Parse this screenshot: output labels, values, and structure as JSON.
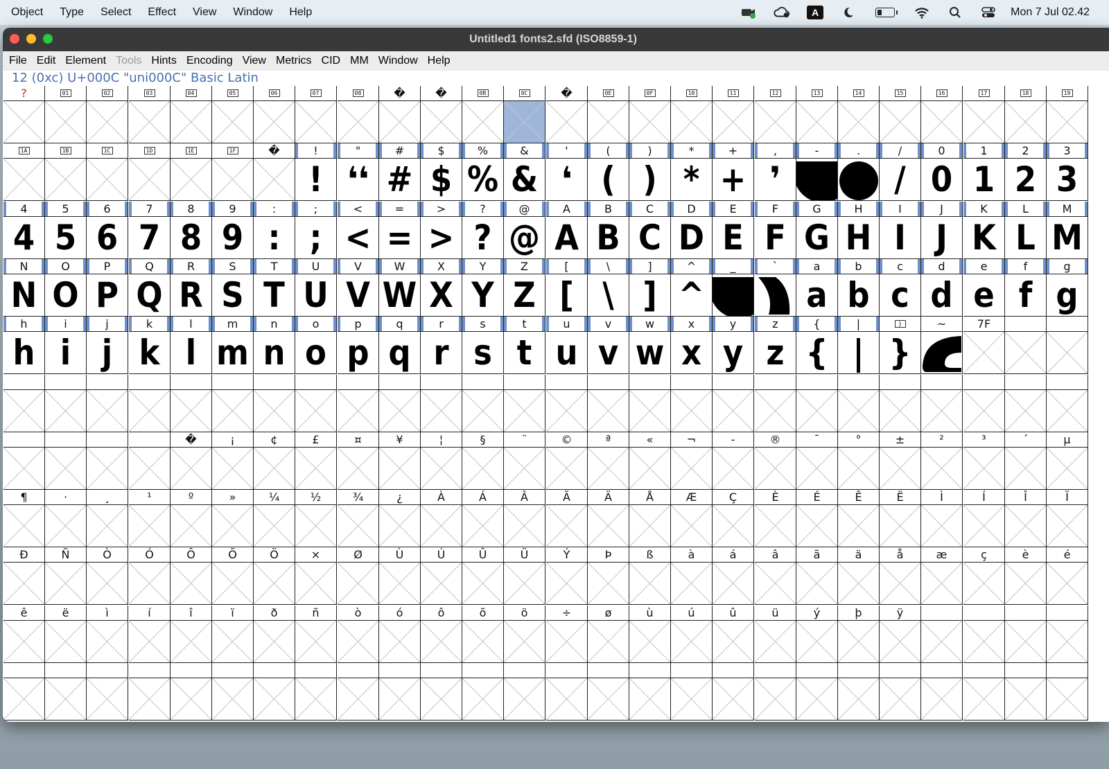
{
  "system_menubar": {
    "items": [
      "Object",
      "Type",
      "Select",
      "Effect",
      "View",
      "Window",
      "Help"
    ],
    "status_icons": [
      "camera-icon",
      "creative-cloud-icon",
      "input-source-icon",
      "moon-icon",
      "battery-icon",
      "wifi-icon",
      "search-icon",
      "control-center-icon"
    ],
    "input_source_letter": "A",
    "clock": "Mon 7 Jul  02.42"
  },
  "window": {
    "title": "Untitled1  fonts2.sfd (ISO8859-1)",
    "menu": [
      {
        "label": "File",
        "enabled": true
      },
      {
        "label": "Edit",
        "enabled": true
      },
      {
        "label": "Element",
        "enabled": true
      },
      {
        "label": "Tools",
        "enabled": false
      },
      {
        "label": "Hints",
        "enabled": true
      },
      {
        "label": "Encoding",
        "enabled": true
      },
      {
        "label": "View",
        "enabled": true
      },
      {
        "label": "Metrics",
        "enabled": true
      },
      {
        "label": "CID",
        "enabled": true
      },
      {
        "label": "MM",
        "enabled": true
      },
      {
        "label": "Window",
        "enabled": true
      },
      {
        "label": "Help",
        "enabled": true
      }
    ],
    "info_line": "12 (0xc) U+000C \"uni000C\" Basic Latin"
  },
  "grid": {
    "columns_visible": 26,
    "selected_index": 12,
    "accent_color": "#6f90c7",
    "selection_color": "#9fb6db",
    "labels": [
      "?",
      "01",
      "02",
      "03",
      "04",
      "05",
      "06",
      "07",
      "08",
      "�",
      "�",
      "0B",
      "0C",
      "�",
      "0E",
      "0F",
      "10",
      "11",
      "12",
      "13",
      "14",
      "15",
      "16",
      "17",
      "18",
      "19",
      "1A",
      "1B",
      "1C",
      "1D",
      "1E",
      "1F",
      "�",
      "!",
      "\"",
      "#",
      "$",
      "%",
      "&",
      "'",
      "(",
      ")",
      "*",
      "+",
      ",",
      "-",
      ".",
      "/",
      "0",
      "1",
      "2",
      "3",
      "4",
      "5",
      "6",
      "7",
      "8",
      "9",
      ":",
      ";",
      "<",
      "=",
      ">",
      "?",
      "@",
      "A",
      "B",
      "C",
      "D",
      "E",
      "F",
      "G",
      "H",
      "I",
      "J",
      "K",
      "L",
      "M",
      "N",
      "O",
      "P",
      "Q",
      "R",
      "S",
      "T",
      "U",
      "V",
      "W",
      "X",
      "Y",
      "Z",
      "[",
      "\\",
      "]",
      "^",
      "_",
      "`",
      "a",
      "b",
      "c",
      "d",
      "e",
      "f",
      "g",
      "h",
      "i",
      "j",
      "k",
      "l",
      "m",
      "n",
      "o",
      "p",
      "q",
      "r",
      "s",
      "t",
      "u",
      "v",
      "w",
      "x",
      "y",
      "z",
      "{",
      "|",
      "}",
      "~",
      "7F",
      "",
      "",
      "",
      "",
      "",
      "",
      "",
      "",
      "",
      "",
      "",
      "",
      "",
      "",
      "",
      "",
      "",
      "",
      "",
      "",
      "",
      "",
      "",
      "",
      "",
      "",
      "",
      "",
      "",
      "",
      "",
      "",
      "�",
      "¡",
      "¢",
      "£",
      "¤",
      "¥",
      "¦",
      "§",
      "¨",
      "©",
      "ª",
      "«",
      "¬",
      "-",
      "®",
      "¯",
      "°",
      "±",
      "²",
      "³",
      "´",
      "µ",
      "¶",
      "·",
      "¸",
      "¹",
      "º",
      "»",
      "¼",
      "½",
      "¾",
      "¿",
      "À",
      "Á",
      "Â",
      "Ã",
      "Ä",
      "Å",
      "Æ",
      "Ç",
      "È",
      "É",
      "Ê",
      "Ë",
      "Ì",
      "Í",
      "Î",
      "Ï",
      "Ð",
      "Ñ",
      "Ò",
      "Ó",
      "Ô",
      "Õ",
      "Ö",
      "×",
      "Ø",
      "Ù",
      "Ú",
      "Û",
      "Ü",
      "Ý",
      "Þ",
      "ß",
      "à",
      "á",
      "â",
      "ã",
      "ä",
      "å",
      "æ",
      "ç",
      "è",
      "é",
      "ê",
      "ë",
      "ì",
      "í",
      "î",
      "ï",
      "ð",
      "ñ",
      "ò",
      "ó",
      "ô",
      "õ",
      "ö",
      "÷",
      "ø",
      "ù",
      "ú",
      "û",
      "ü",
      "ý",
      "þ",
      "ÿ",
      "",
      "",
      "",
      "",
      "",
      "",
      "",
      "",
      "",
      "",
      "",
      "",
      "",
      "",
      "",
      "",
      "",
      "",
      "",
      "",
      "",
      "",
      "",
      "",
      "",
      "",
      "",
      "",
      "",
      ""
    ],
    "hex_label_indices": [
      1,
      2,
      3,
      4,
      5,
      6,
      7,
      8,
      11,
      12,
      14,
      15,
      16,
      17,
      18,
      19,
      20,
      21,
      22,
      23,
      24,
      25,
      26,
      27,
      28,
      29,
      30,
      31,
      125
    ],
    "red_label_indices": [
      0
    ],
    "defined_ranges": [
      [
        33,
        124
      ]
    ],
    "glyph_text": {
      "33": "!",
      "34": "❛❛",
      "35": "#",
      "36": "$",
      "37": "%",
      "38": "&",
      "39": "❛",
      "40": "(",
      "41": ")",
      "42": "*",
      "43": "+",
      "44": "❜",
      "47": "/",
      "48": "0",
      "49": "1",
      "50": "2",
      "51": "3",
      "52": "4",
      "53": "5",
      "54": "6",
      "55": "7",
      "56": "8",
      "57": "9",
      "58": ":",
      "59": ";",
      "60": "<",
      "61": "=",
      "62": ">",
      "63": "?",
      "64": "@",
      "65": "A",
      "66": "B",
      "67": "C",
      "68": "D",
      "69": "E",
      "70": "F",
      "71": "G",
      "72": "H",
      "73": "I",
      "74": "J",
      "75": "K",
      "76": "L",
      "77": "M",
      "78": "N",
      "79": "O",
      "80": "P",
      "81": "Q",
      "82": "R",
      "83": "S",
      "84": "T",
      "85": "U",
      "86": "V",
      "87": "W",
      "88": "X",
      "89": "Y",
      "90": "Z",
      "91": "[",
      "92": "\\",
      "93": "]",
      "94": "^",
      "97": "a",
      "98": "b",
      "99": "c",
      "100": "d",
      "101": "e",
      "102": "f",
      "103": "g",
      "104": "h",
      "105": "i",
      "106": "j",
      "107": "k",
      "108": "l",
      "109": "m",
      "110": "n",
      "111": "o",
      "112": "p",
      "113": "q",
      "114": "r",
      "115": "s",
      "116": "t",
      "117": "u",
      "118": "v",
      "119": "w",
      "120": "x",
      "121": "y",
      "122": "z",
      "123": "{",
      "124": "|",
      "125": "}"
    },
    "glyph_shapes": {
      "45": "half-disc",
      "46": "disc",
      "95": "half-disc",
      "96": "tear",
      "126": "hook"
    },
    "empty_glyph_indices": [
      125,
      127,
      128,
      129,
      130,
      131,
      132,
      133,
      134,
      135,
      136,
      137,
      138,
      139,
      140,
      141,
      142,
      143,
      144,
      145,
      146,
      147,
      148,
      149,
      150,
      151,
      152,
      153,
      154,
      155,
      156,
      157,
      158,
      159,
      160,
      161,
      162,
      163,
      164,
      165,
      166,
      167,
      168,
      169,
      170,
      171,
      172,
      173,
      174,
      175,
      176,
      177
    ]
  }
}
